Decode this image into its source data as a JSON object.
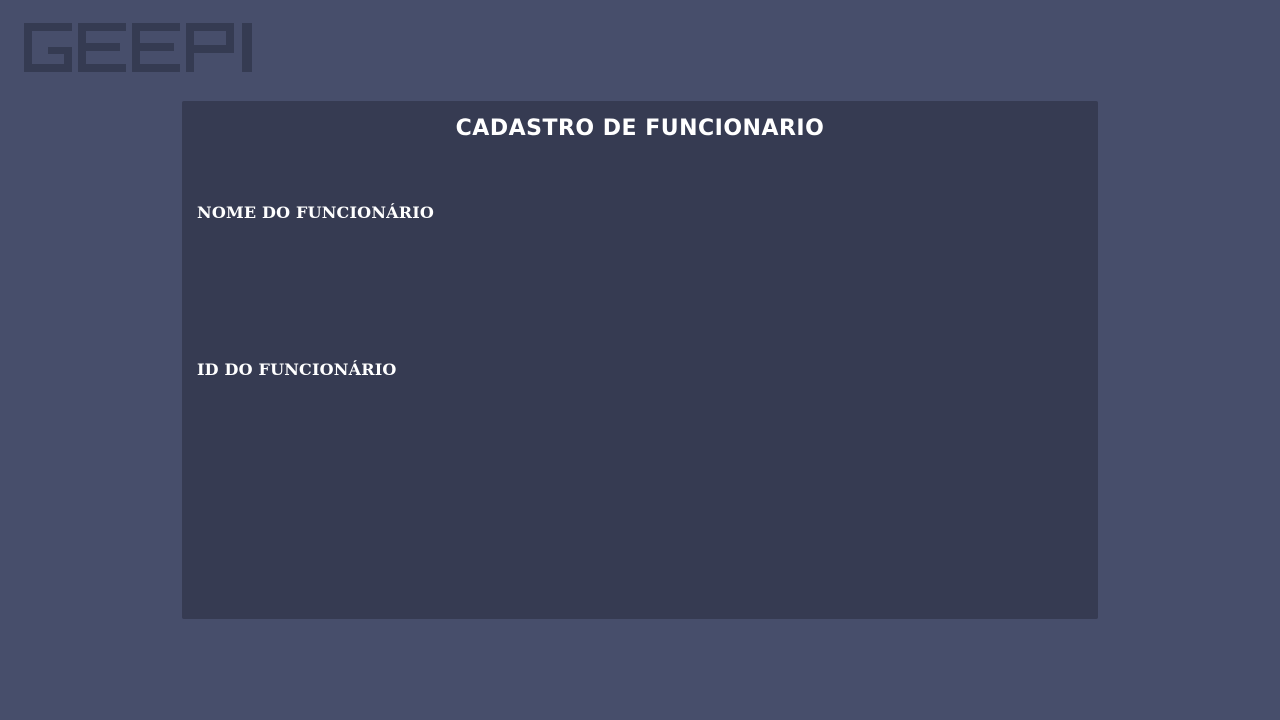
{
  "header": {
    "logo_text": "GEEPI",
    "logo_color": "#353b52"
  },
  "form": {
    "title": "CADASTRO DE FUNCIONARIO",
    "fields": [
      {
        "label": "NOME DO FUNCIONÁRIO",
        "value": ""
      },
      {
        "label": "ID DO FUNCIONÁRIO",
        "value": ""
      }
    ]
  },
  "colors": {
    "background": "#474e6b",
    "panel": "#363b52",
    "text": "#ffffff"
  }
}
